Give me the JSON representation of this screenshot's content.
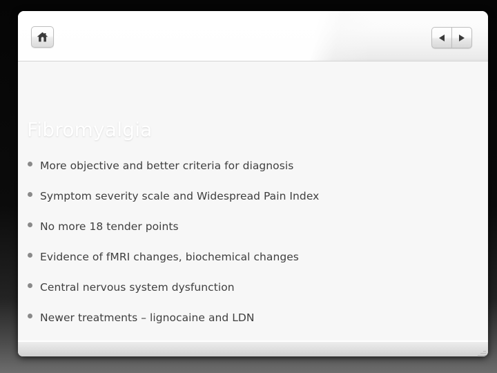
{
  "window": {
    "toolbar": {
      "home_button_label": "Home",
      "home_icon": "home-icon",
      "prev_button_label": "Previous slide",
      "prev_icon": "triangle-left-icon",
      "next_button_label": "Next slide",
      "next_icon": "triangle-right-icon"
    },
    "status_bar": {
      "text": "",
      "resize_grip_icon": "resize-grip-icon"
    }
  },
  "slide": {
    "title": "Fibromyalgia",
    "bullets": [
      {
        "text": "More objective and better criteria for diagnosis"
      },
      {
        "text": "Symptom severity scale and Widespread Pain Index"
      },
      {
        "text": "No more 18  tender points"
      },
      {
        "text": "Evidence of fMRI changes, biochemical changes"
      },
      {
        "text": "Central nervous system dysfunction"
      },
      {
        "text": "Newer treatments – lignocaine and LDN"
      }
    ]
  },
  "colors": {
    "banner_top": "#2e4486",
    "banner_bottom": "#62b0f0",
    "title_text": "#ffffff",
    "body_text": "#3f3f3f",
    "bullet_dot": "#8a8a8a",
    "slide_background": "#f7f7f7",
    "frame_background": "#000000"
  }
}
